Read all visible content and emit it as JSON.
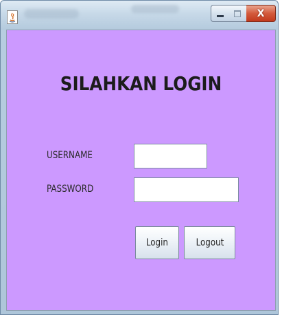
{
  "window": {
    "icon": "java-icon",
    "controls": {
      "minimize": "minimize-icon",
      "maximize": "maximize-icon",
      "close_label": "X"
    }
  },
  "form": {
    "heading": "SILAHKAN LOGIN",
    "username_label": "USERNAME",
    "password_label": "PASSWORD",
    "username_value": "",
    "password_value": "",
    "login_button": "Login",
    "logout_button": "Logout"
  },
  "colors": {
    "panel_background": "#cc99ff",
    "close_button": "#c94a2c"
  }
}
